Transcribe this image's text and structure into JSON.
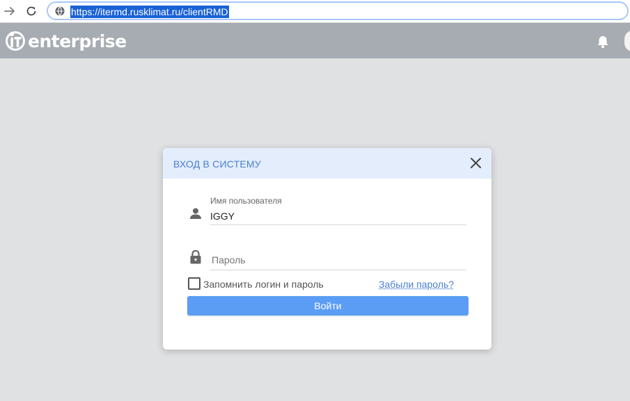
{
  "browser": {
    "url": "https://itermd.rusklimat.ru/clientRMD"
  },
  "app": {
    "logo_text": "enterprise",
    "bell_icon": "bell-icon"
  },
  "dialog": {
    "title": "ВХОД В СИСТЕМУ",
    "username_label": "Имя пользователя",
    "username_value": "IGGY",
    "password_placeholder": "Пароль",
    "remember_label": "Запомнить логин и пароль",
    "remember_checked": false,
    "forgot_link": "Забыли пароль?",
    "login_button": "Войти"
  },
  "colors": {
    "header_bg": "#a6acb1",
    "dialog_head_bg": "#e3edfc",
    "accent": "#4a7fd0",
    "button": "#5b9df5"
  }
}
